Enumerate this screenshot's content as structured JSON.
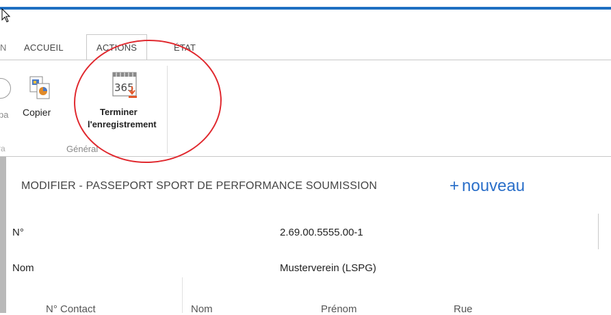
{
  "colors": {
    "accent_blue": "#1e6fc2",
    "link_blue": "#2a6fc9",
    "annotation_red": "#e0282e"
  },
  "tabs": {
    "edge": "N",
    "items": [
      {
        "label": "ACCUEIL"
      },
      {
        "label": "ACTIONS"
      },
      {
        "label": "ÉTAT"
      }
    ]
  },
  "ribbon": {
    "copy_label": "Copier",
    "finish_label_line1": "Terminer",
    "finish_label_line2": "l'enregistrement",
    "calendar_number": "365",
    "group_label": "Général",
    "left_partial_label": "pa",
    "left_partial_group": "ra"
  },
  "form": {
    "title": "MODIFIER - PASSEPORT SPORT DE PERFORMANCE SOUMISSION",
    "new_label": "nouveau",
    "new_symbol": "+",
    "fields": [
      {
        "label": "N°",
        "value": "2.69.00.5555.00-1"
      },
      {
        "label": "Nom",
        "value": "Musterverein (LSPG)"
      }
    ],
    "columns": [
      "N° Contact",
      "Nom",
      "Prénom",
      "Rue"
    ]
  }
}
